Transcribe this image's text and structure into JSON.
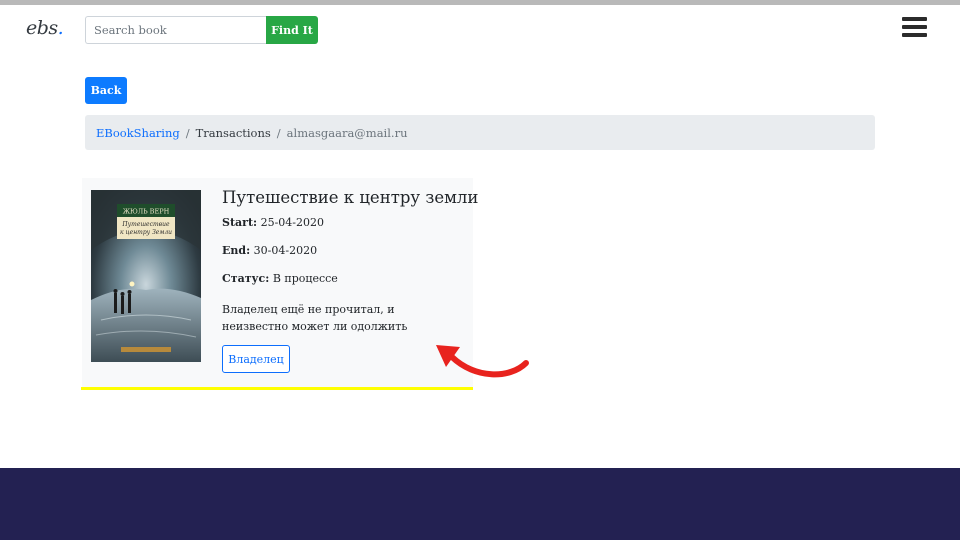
{
  "navbar": {
    "logo_main": "ebs",
    "logo_dot": ".",
    "search_placeholder": "Search book",
    "search_button": "Find It",
    "menu_icon": "hamburger-menu-icon"
  },
  "back_label": "Back",
  "breadcrumb": {
    "home": "EBookSharing",
    "separator": "/",
    "section": "Transactions",
    "user": "almasgaara@mail.ru"
  },
  "transaction": {
    "title": "Путешествие к центру земли",
    "start_label": "Start:",
    "start_value": "25-04-2020",
    "end_label": "End:",
    "end_value": "30-04-2020",
    "status_label": "Статус:",
    "status_value": "В процессе",
    "description": "Владелец ещё не прочитал, и неизвестно может ли одолжить",
    "owner_button": "Владелец",
    "cover": {
      "author": "ЖЮЛЬ ВЕРН",
      "title_line1": "Путешествие",
      "title_line2": "к центру Земли"
    }
  },
  "colors": {
    "primary": "#0d7bff",
    "success": "#28a745",
    "highlight": "#ffff00",
    "annotation_arrow": "#e8231e",
    "footer": "#232152"
  }
}
